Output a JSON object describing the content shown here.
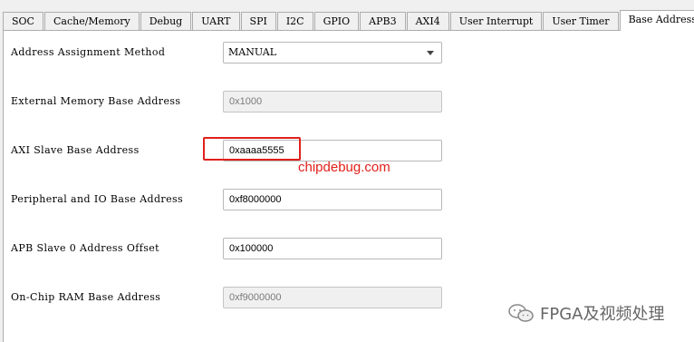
{
  "tabs": [
    {
      "label": "SOC"
    },
    {
      "label": "Cache/Memory"
    },
    {
      "label": "Debug"
    },
    {
      "label": "UART"
    },
    {
      "label": "SPI"
    },
    {
      "label": "I2C"
    },
    {
      "label": "GPIO"
    },
    {
      "label": "APB3"
    },
    {
      "label": "AXI4"
    },
    {
      "label": "User Interrupt"
    },
    {
      "label": "User Timer"
    },
    {
      "label": "Base Address"
    }
  ],
  "active_tab": "Base Address",
  "form": {
    "address_assignment": {
      "label": "Address Assignment Method",
      "value": "MANUAL"
    },
    "external_memory": {
      "label": "External Memory Base Address",
      "value": "0x1000"
    },
    "axi_slave": {
      "label": "AXI Slave Base Address",
      "value": "0xaaaa5555"
    },
    "peripheral_io": {
      "label": "Peripheral and IO Base Address",
      "value": "0xf8000000"
    },
    "apb_slave": {
      "label": "APB Slave 0 Address Offset",
      "value": "0x100000"
    },
    "onchip_ram": {
      "label": "On-Chip RAM Base Address",
      "value": "0xf9000000"
    }
  },
  "watermark": {
    "site": "chipdebug.com",
    "brand": "FPGA及视频处理"
  },
  "colors": {
    "highlight": "#e0201b",
    "disabled_bg": "#f0f0f0"
  }
}
